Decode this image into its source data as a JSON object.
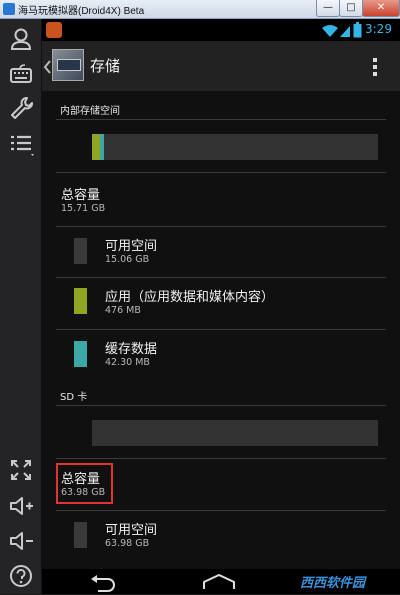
{
  "window": {
    "title": "海马玩模拟器(Droid4X) Beta",
    "minimize": "—",
    "maximize": "□",
    "close": "✕"
  },
  "status": {
    "time": "3:29"
  },
  "actionbar": {
    "title": "存储"
  },
  "internal": {
    "header": "内部存储空间",
    "total_label": "总容量",
    "total_value": "15.71 GB",
    "items": [
      {
        "label": "可用空间",
        "value": "15.06 GB",
        "color": "#3a3a3a"
      },
      {
        "label": "应用（应用数据和媒体内容）",
        "value": "476 MB",
        "color": "#8fa523"
      },
      {
        "label": "缓存数据",
        "value": "42.30 MB",
        "color": "#3da7a6"
      }
    ]
  },
  "sd": {
    "header": "SD 卡",
    "total_label": "总容量",
    "total_value": "63.98 GB",
    "items": [
      {
        "label": "可用空间",
        "value": "63.98 GB",
        "color": "#3a3a3a"
      }
    ]
  },
  "icons": [
    "user-icon",
    "keyboard-icon",
    "wrench-icon",
    "menu-list-icon",
    "fullscreen-icon",
    "volume-up-icon",
    "volume-down-icon",
    "help-icon",
    "back-icon",
    "home-icon",
    "wifi-icon",
    "signal-icon",
    "battery-icon",
    "overflow-menu-icon",
    "up-chevron-icon"
  ],
  "watermark": "西西软件园"
}
